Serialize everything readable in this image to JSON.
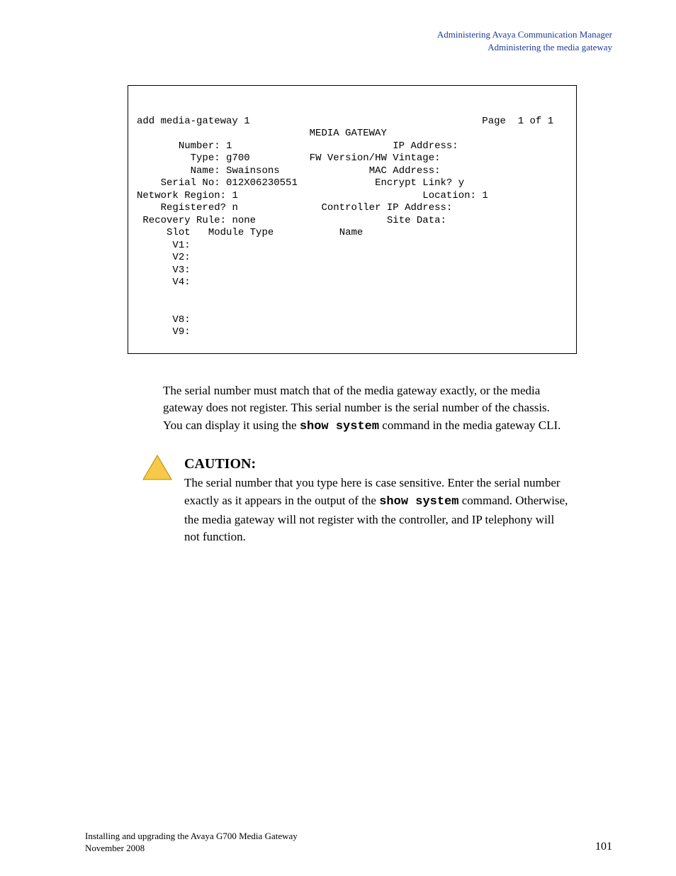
{
  "header": {
    "line1": "Administering Avaya Communication Manager",
    "line2": "Administering the media gateway"
  },
  "terminal": {
    "command": "add media-gateway 1",
    "page_label": "Page  1 of 1",
    "title": "MEDIA GATEWAY",
    "left": {
      "number_label": "Number:",
      "number_value": "1",
      "type_label": "Type:",
      "type_value": "g700",
      "name_label": "Name:",
      "name_value": "Swainsons",
      "serial_label": "Serial No:",
      "serial_value": "012X06230551",
      "network_region_label": "Network Region:",
      "network_region_value": "1",
      "registered_label": "Registered?",
      "registered_value": "n",
      "recovery_label": "Recovery Rule:",
      "recovery_value": "none"
    },
    "right": {
      "ip_label": "IP Address:",
      "fw_label": "FW Version/HW Vintage:",
      "mac_label": "MAC Address:",
      "encrypt_label": "Encrypt Link?",
      "encrypt_value": "y",
      "location_label": "Location:",
      "location_value": "1",
      "controller_label": "Controller IP Address:",
      "site_label": "Site Data:"
    },
    "table": {
      "col1": "Slot",
      "col2": "Module Type",
      "col3": "Name",
      "rows": [
        "V1:",
        "V2:",
        "V3:",
        "V4:",
        "",
        "",
        "V8:",
        "V9:"
      ]
    }
  },
  "body": {
    "para1a": "The serial number must match that of the media gateway exactly, or the media gateway does not register. This serial number is the serial number of the chassis. You can display it using the ",
    "cmd1": "show system",
    "para1b": " command in the media gateway CLI.",
    "caution_label": "CAUTION:",
    "caution_a": "The serial number that you type here is case sensitive. Enter the serial number exactly as it appears in the output of the ",
    "cmd2": "show system",
    "caution_b": " command. Otherwise, the media gateway will not register with the controller, and IP telephony will not function."
  },
  "footer": {
    "line1": "Installing and upgrading the Avaya G700 Media Gateway",
    "line2": "",
    "line3": "November 2008",
    "page": "101"
  }
}
